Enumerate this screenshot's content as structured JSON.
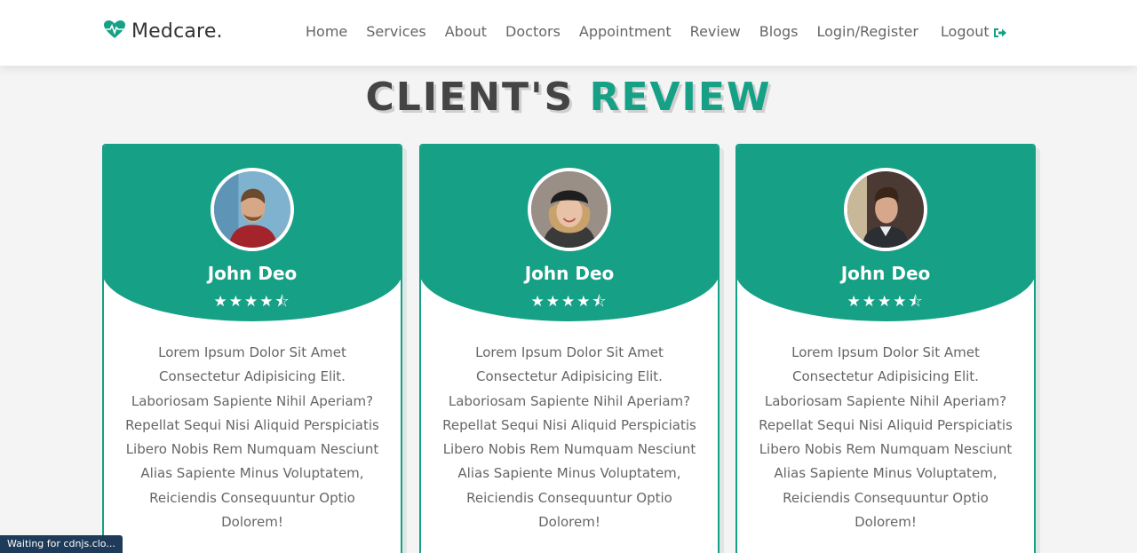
{
  "brand": {
    "name": "Medcare.",
    "accent": "#16a085"
  },
  "nav": {
    "items": [
      "Home",
      "Services",
      "About",
      "Doctors",
      "Appointment",
      "Review",
      "Blogs",
      "Login/Register"
    ],
    "logout": "Logout"
  },
  "heading": {
    "part1": "CLIENT'S",
    "part2": "REVIEW"
  },
  "reviews": [
    {
      "name": "John Deo",
      "rating": 4.5,
      "stars": "★★★★⯪",
      "text": "Lorem Ipsum Dolor Sit Amet Consectetur Adipisicing Elit. Laboriosam Sapiente Nihil Aperiam? Repellat Sequi Nisi Aliquid Perspiciatis Libero Nobis Rem Numquam Nesciunt Alias Sapiente Minus Voluptatem, Reiciendis Consequuntur Optio Dolorem!"
    },
    {
      "name": "John Deo",
      "rating": 4.5,
      "stars": "★★★★⯪",
      "text": "Lorem Ipsum Dolor Sit Amet Consectetur Adipisicing Elit. Laboriosam Sapiente Nihil Aperiam? Repellat Sequi Nisi Aliquid Perspiciatis Libero Nobis Rem Numquam Nesciunt Alias Sapiente Minus Voluptatem, Reiciendis Consequuntur Optio Dolorem!"
    },
    {
      "name": "John Deo",
      "rating": 4.5,
      "stars": "★★★★⯪",
      "text": "Lorem Ipsum Dolor Sit Amet Consectetur Adipisicing Elit. Laboriosam Sapiente Nihil Aperiam? Repellat Sequi Nisi Aliquid Perspiciatis Libero Nobis Rem Numquam Nesciunt Alias Sapiente Minus Voluptatem, Reiciendis Consequuntur Optio Dolorem!"
    }
  ],
  "status_bar": "Waiting for cdnjs.clo..."
}
